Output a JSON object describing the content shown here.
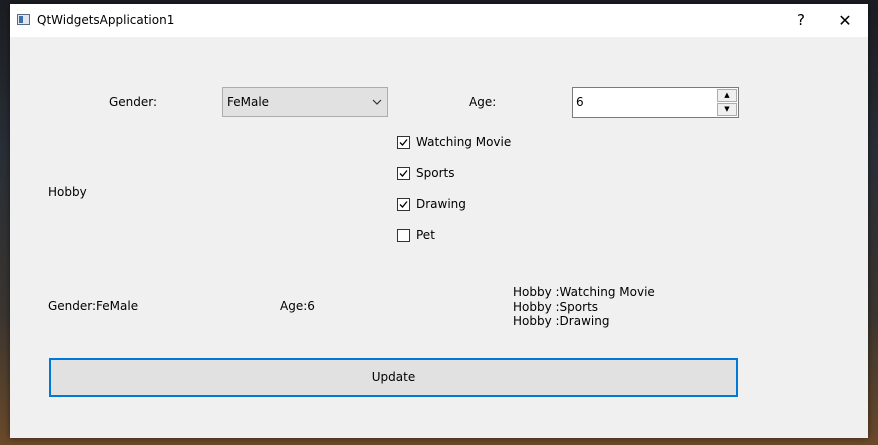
{
  "window": {
    "title": "QtWidgetsApplication1",
    "help_glyph": "?",
    "close_glyph": "✕"
  },
  "form": {
    "gender_label": "Gender:",
    "gender_value": "FeMale",
    "age_label": "Age:",
    "age_value": "6",
    "hobby_label": "Hobby",
    "hobbies": [
      {
        "label": "Watching Movie",
        "checked": true
      },
      {
        "label": "Sports",
        "checked": true
      },
      {
        "label": "Drawing",
        "checked": true
      },
      {
        "label": "Pet",
        "checked": false
      }
    ]
  },
  "result": {
    "gender_text": "Gender:FeMale",
    "age_text": "Age:6",
    "hobby_lines": [
      "Hobby :Watching Movie",
      "Hobby :Sports",
      "Hobby :Drawing"
    ]
  },
  "update_button_label": "Update",
  "icons": {
    "app": "app-window-icon",
    "dropdown": "chevron-down-icon",
    "check": "check-icon"
  }
}
